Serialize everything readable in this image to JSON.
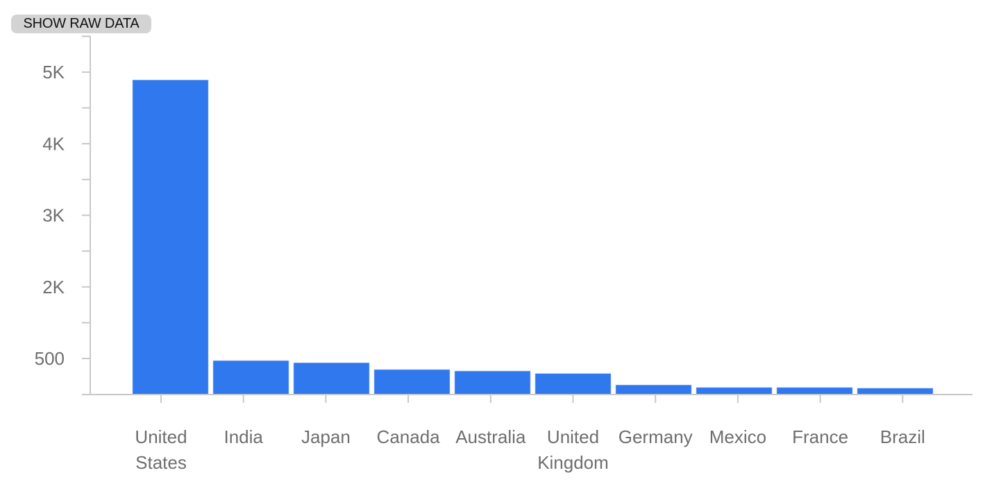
{
  "toolbar": {
    "show_raw_data_label": "SHOW RAW DATA"
  },
  "colors": {
    "bar": "#2f78ee",
    "axis": "#c8c8c8",
    "tick_label": "#6e6e6e",
    "button_bg": "#d3d3d3"
  },
  "chart_data": {
    "type": "bar",
    "title": "",
    "xlabel": "",
    "ylabel": "",
    "categories": [
      [
        "United",
        "States"
      ],
      [
        "India"
      ],
      [
        "Japan"
      ],
      [
        "Canada"
      ],
      [
        "Australia"
      ],
      [
        "United",
        "Kingdom"
      ],
      [
        "Germany"
      ],
      [
        "Mexico"
      ],
      [
        "France"
      ],
      [
        "Brazil"
      ]
    ],
    "category_names": [
      "United States",
      "India",
      "Japan",
      "Canada",
      "Australia",
      "United Kingdom",
      "Germany",
      "Mexico",
      "France",
      "Brazil"
    ],
    "values": [
      4890,
      970,
      940,
      845,
      825,
      790,
      630,
      595,
      595,
      585
    ],
    "ylim": [
      500,
      5500
    ],
    "y_ticks": [
      {
        "value": 1000,
        "label": "500"
      },
      {
        "value": 2000,
        "label": "2K"
      },
      {
        "value": 3000,
        "label": "3K"
      },
      {
        "value": 4000,
        "label": "4K"
      },
      {
        "value": 5000,
        "label": "5K"
      }
    ],
    "y_minor_ticks": [
      1500,
      2500,
      3500,
      4500,
      5500
    ],
    "grid": false,
    "legend": "none"
  }
}
